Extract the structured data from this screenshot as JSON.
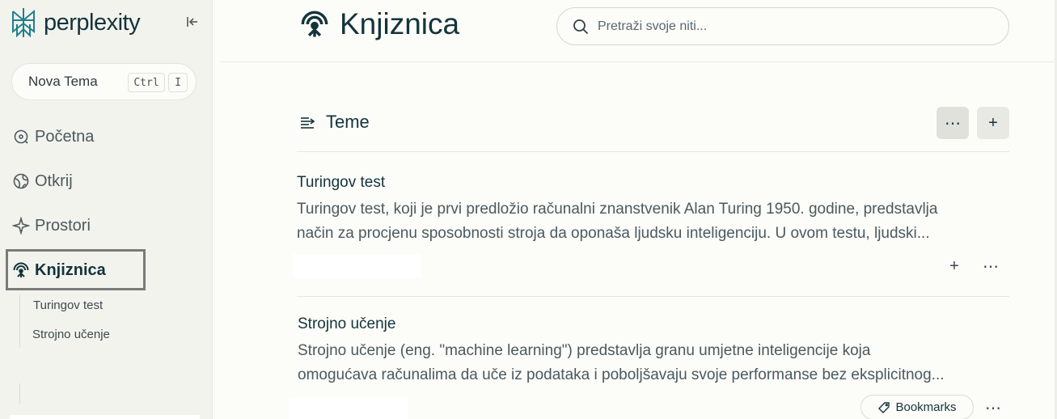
{
  "app": {
    "logo_text": "perplexity"
  },
  "sidebar": {
    "new_topic": {
      "label": "Nova Tema",
      "shortcut_key1": "Ctrl",
      "shortcut_key2": "I"
    },
    "items": [
      {
        "label": "Početna",
        "icon": "compass-icon"
      },
      {
        "label": "Otkrij",
        "icon": "globe-icon"
      },
      {
        "label": "Prostori",
        "icon": "sparkle-icon"
      },
      {
        "label": "Knjiznica",
        "icon": "library-icon",
        "active": true
      }
    ],
    "library_threads": [
      "Turingov test",
      "Strojno učenje"
    ]
  },
  "header": {
    "title": "Knjiznica",
    "search_placeholder": "Pretraži svoje niti..."
  },
  "main": {
    "section_title": "Teme",
    "threads": [
      {
        "title": "Turingov test",
        "snippet_line1": "Turingov test, koji je prvi predložio računalni znanstvenik Alan Turing 1950. godine, predstavlja",
        "snippet_line2": "način za procjenu sposobnosti stroja da oponaša ljudsku inteligenciju. U ovom testu, ljudski..."
      },
      {
        "title": "Strojno učenje",
        "snippet_line1": "Strojno učenje (eng. \"machine learning\") predstavlja granu umjetne inteligencije koja",
        "snippet_line2": "omogućava računalima da uče iz podataka i poboljšavaju svoje performanse bez eksplicitnog...",
        "tag": "Bookmarks"
      }
    ]
  },
  "colors": {
    "text": "#13343b",
    "accent": "#20808d",
    "sidebar_bg": "#f3f3ee",
    "page_bg": "#fcfcf9"
  }
}
